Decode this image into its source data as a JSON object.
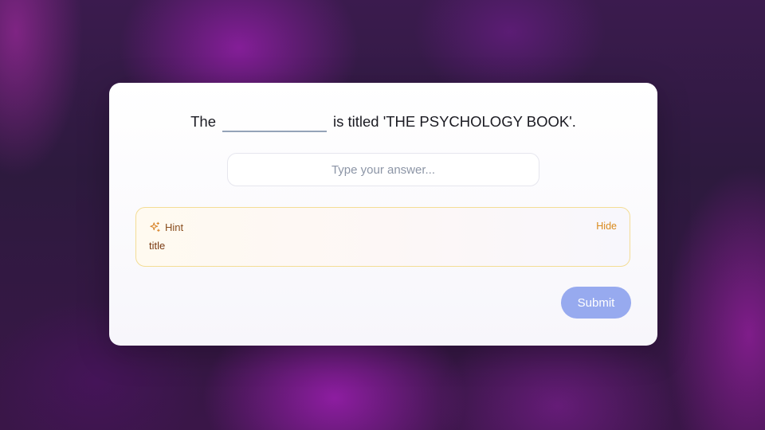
{
  "question": {
    "before": "The",
    "after": "is titled 'THE PSYCHOLOGY BOOK'."
  },
  "answer_input": {
    "value": "",
    "placeholder": "Type your answer..."
  },
  "hint": {
    "icon": "sparkles-icon",
    "title": "Hint",
    "toggle_label": "Hide",
    "text": "title"
  },
  "submit": {
    "label": "Submit"
  },
  "colors": {
    "accent": "#97aaef",
    "hint_border": "#f4dd95",
    "hint_action": "#d98a1c"
  }
}
